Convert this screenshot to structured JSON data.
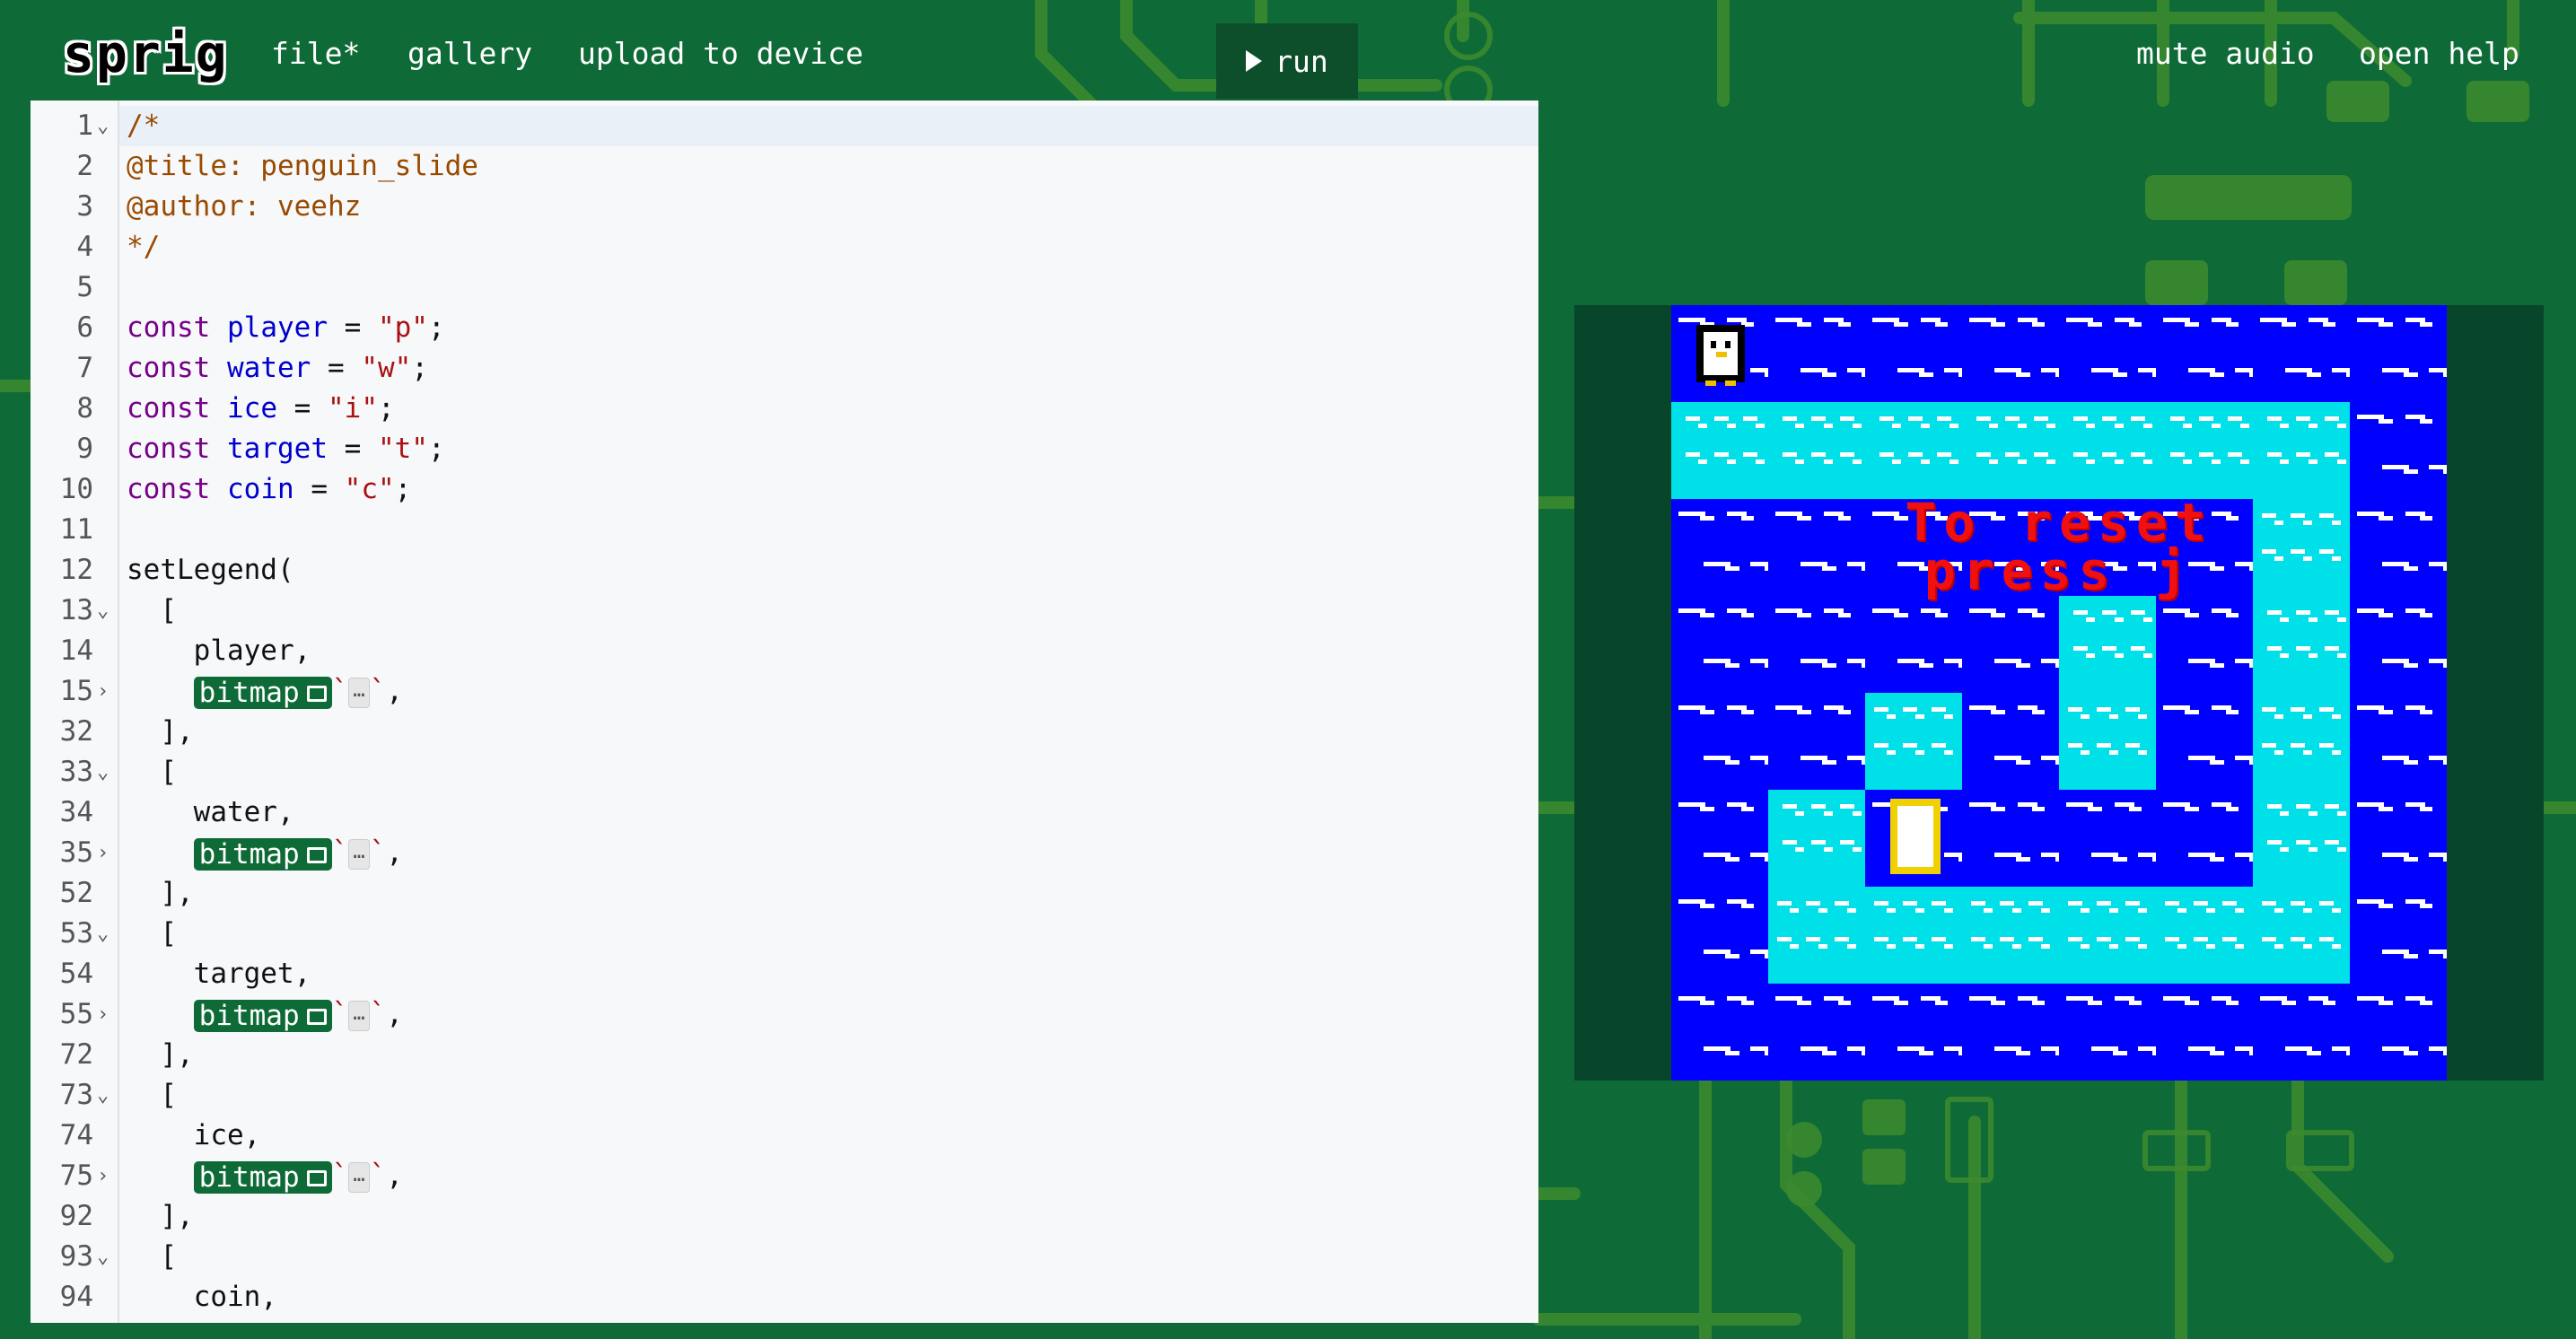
{
  "nav": {
    "logo": "sprig",
    "file_label": "file*",
    "gallery_label": "gallery",
    "upload_label": "upload to device",
    "run_label": "run",
    "mute_label": "mute audio",
    "help_label": "open help"
  },
  "colors": {
    "background": "#0e6b37",
    "water": "#0000ff",
    "ice": "#00e0e8",
    "message": "#f01010",
    "bitmap_chip": "#0e6b37"
  },
  "editor": {
    "lines": [
      {
        "n": "1",
        "fold": "open",
        "segs": [
          {
            "t": "/*",
            "c": "comment"
          }
        ]
      },
      {
        "n": "2",
        "segs": [
          {
            "t": "@title: penguin_slide",
            "c": "comment"
          }
        ]
      },
      {
        "n": "3",
        "segs": [
          {
            "t": "@author: veehz",
            "c": "comment"
          }
        ]
      },
      {
        "n": "4",
        "segs": [
          {
            "t": "*/",
            "c": "comment"
          }
        ]
      },
      {
        "n": "5",
        "segs": []
      },
      {
        "n": "6",
        "segs": [
          {
            "t": "const",
            "c": "kw"
          },
          {
            "t": " "
          },
          {
            "t": "player",
            "c": "var"
          },
          {
            "t": " = "
          },
          {
            "t": "\"p\"",
            "c": "str"
          },
          {
            "t": ";"
          }
        ]
      },
      {
        "n": "7",
        "segs": [
          {
            "t": "const",
            "c": "kw"
          },
          {
            "t": " "
          },
          {
            "t": "water",
            "c": "var"
          },
          {
            "t": " = "
          },
          {
            "t": "\"w\"",
            "c": "str"
          },
          {
            "t": ";"
          }
        ]
      },
      {
        "n": "8",
        "segs": [
          {
            "t": "const",
            "c": "kw"
          },
          {
            "t": " "
          },
          {
            "t": "ice",
            "c": "var"
          },
          {
            "t": " = "
          },
          {
            "t": "\"i\"",
            "c": "str"
          },
          {
            "t": ";"
          }
        ]
      },
      {
        "n": "9",
        "segs": [
          {
            "t": "const",
            "c": "kw"
          },
          {
            "t": " "
          },
          {
            "t": "target",
            "c": "var"
          },
          {
            "t": " = "
          },
          {
            "t": "\"t\"",
            "c": "str"
          },
          {
            "t": ";"
          }
        ]
      },
      {
        "n": "10",
        "segs": [
          {
            "t": "const",
            "c": "kw"
          },
          {
            "t": " "
          },
          {
            "t": "coin",
            "c": "var"
          },
          {
            "t": " = "
          },
          {
            "t": "\"c\"",
            "c": "str"
          },
          {
            "t": ";"
          }
        ]
      },
      {
        "n": "11",
        "segs": []
      },
      {
        "n": "12",
        "segs": [
          {
            "t": "setLegend("
          }
        ]
      },
      {
        "n": "13",
        "fold": "open",
        "segs": [
          {
            "t": "  ["
          }
        ]
      },
      {
        "n": "14",
        "segs": [
          {
            "t": "    player,"
          }
        ]
      },
      {
        "n": "15",
        "fold": "closed",
        "bitmap": true
      },
      {
        "n": "32",
        "segs": [
          {
            "t": "  ],"
          }
        ]
      },
      {
        "n": "33",
        "fold": "open",
        "segs": [
          {
            "t": "  ["
          }
        ]
      },
      {
        "n": "34",
        "segs": [
          {
            "t": "    water,"
          }
        ]
      },
      {
        "n": "35",
        "fold": "closed",
        "bitmap": true
      },
      {
        "n": "52",
        "segs": [
          {
            "t": "  ],"
          }
        ]
      },
      {
        "n": "53",
        "fold": "open",
        "segs": [
          {
            "t": "  ["
          }
        ]
      },
      {
        "n": "54",
        "segs": [
          {
            "t": "    target,"
          }
        ]
      },
      {
        "n": "55",
        "fold": "closed",
        "bitmap": true
      },
      {
        "n": "72",
        "segs": [
          {
            "t": "  ],"
          }
        ]
      },
      {
        "n": "73",
        "fold": "open",
        "segs": [
          {
            "t": "  ["
          }
        ]
      },
      {
        "n": "74",
        "segs": [
          {
            "t": "    ice,"
          }
        ]
      },
      {
        "n": "75",
        "fold": "closed",
        "bitmap": true
      },
      {
        "n": "92",
        "segs": [
          {
            "t": "  ],"
          }
        ]
      },
      {
        "n": "93",
        "fold": "open",
        "segs": [
          {
            "t": "  ["
          }
        ]
      },
      {
        "n": "94",
        "segs": [
          {
            "t": "    coin,"
          }
        ]
      }
    ],
    "bitmap_label": "bitmap",
    "ellipsis": "…"
  },
  "game": {
    "message_line1": "To reset",
    "message_line2": "press j",
    "grid": [
      "pwwwwwww",
      "iiiiiiiw",
      "wwwwwwiw",
      "wwwwiwiw",
      "wwiwiwiw",
      "wicwwwiw",
      "wiiiiiiw",
      "wwwwwwww"
    ]
  }
}
